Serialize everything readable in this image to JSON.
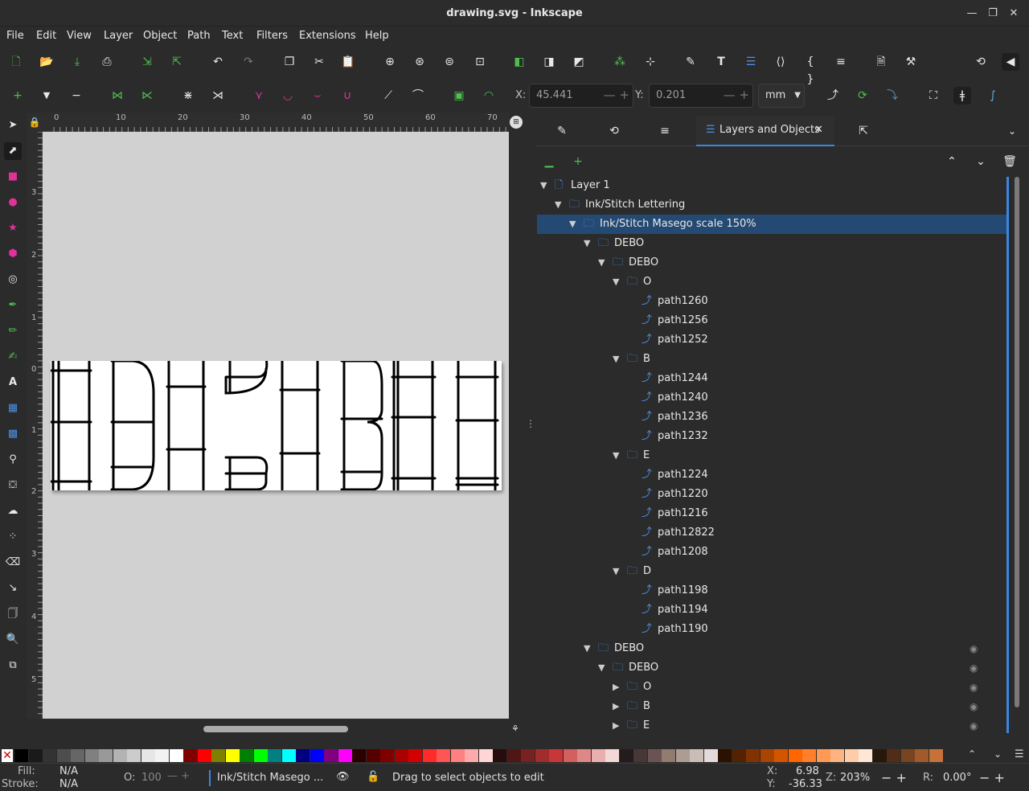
{
  "window": {
    "title": "drawing.svg - Inkscape"
  },
  "menu": [
    "File",
    "Edit",
    "View",
    "Layer",
    "Object",
    "Path",
    "Text",
    "Filters",
    "Extensions",
    "Help"
  ],
  "toolbar2": {
    "x_label": "X:",
    "x_value": "45.441",
    "y_label": "Y:",
    "y_value": "0.201",
    "unit": "mm"
  },
  "ruler_top": [
    "0",
    "10",
    "20",
    "30",
    "40",
    "50",
    "60",
    "70"
  ],
  "ruler_left": [
    "3",
    "2",
    "1",
    "0",
    "1",
    "2",
    "3",
    "4",
    "5"
  ],
  "panel": {
    "active_tab": "Layers and Objects"
  },
  "tree": [
    {
      "label": "Layer 1",
      "level": 0,
      "type": "layer",
      "expanded": true
    },
    {
      "label": "Ink/Stitch Lettering",
      "level": 1,
      "type": "group",
      "expanded": true
    },
    {
      "label": "Ink/Stitch Masego scale 150%",
      "level": 2,
      "type": "group",
      "expanded": true,
      "selected": true
    },
    {
      "label": "DEBO",
      "level": 3,
      "type": "group",
      "expanded": true
    },
    {
      "label": "DEBO",
      "level": 4,
      "type": "group",
      "expanded": true
    },
    {
      "label": "O",
      "level": 5,
      "type": "group",
      "expanded": true
    },
    {
      "label": "path1260",
      "level": 6,
      "type": "path"
    },
    {
      "label": "path1256",
      "level": 6,
      "type": "path"
    },
    {
      "label": "path1252",
      "level": 6,
      "type": "path"
    },
    {
      "label": "B",
      "level": 5,
      "type": "group",
      "expanded": true
    },
    {
      "label": "path1244",
      "level": 6,
      "type": "path"
    },
    {
      "label": "path1240",
      "level": 6,
      "type": "path"
    },
    {
      "label": "path1236",
      "level": 6,
      "type": "path"
    },
    {
      "label": "path1232",
      "level": 6,
      "type": "path"
    },
    {
      "label": "E",
      "level": 5,
      "type": "group",
      "expanded": true
    },
    {
      "label": "path1224",
      "level": 6,
      "type": "path"
    },
    {
      "label": "path1220",
      "level": 6,
      "type": "path"
    },
    {
      "label": "path1216",
      "level": 6,
      "type": "path"
    },
    {
      "label": "path12822",
      "level": 6,
      "type": "path"
    },
    {
      "label": "path1208",
      "level": 6,
      "type": "path"
    },
    {
      "label": "D",
      "level": 5,
      "type": "group",
      "expanded": true
    },
    {
      "label": "path1198",
      "level": 6,
      "type": "path"
    },
    {
      "label": "path1194",
      "level": 6,
      "type": "path"
    },
    {
      "label": "path1190",
      "level": 6,
      "type": "path"
    },
    {
      "label": "DEBO",
      "level": 3,
      "type": "group",
      "expanded": true,
      "hidden": true
    },
    {
      "label": "DEBO",
      "level": 4,
      "type": "group",
      "expanded": true,
      "hidden": true
    },
    {
      "label": "O",
      "level": 5,
      "type": "group",
      "expanded": false,
      "hidden": true
    },
    {
      "label": "B",
      "level": 5,
      "type": "group",
      "expanded": false,
      "hidden": true
    },
    {
      "label": "E",
      "level": 5,
      "type": "group",
      "expanded": false,
      "hidden": true
    }
  ],
  "status": {
    "fill_label": "Fill:",
    "fill_value": "N/A",
    "stroke_label": "Stroke:",
    "stroke_value": "N/A",
    "opacity_label": "O:",
    "opacity_value": "100",
    "layer": "Ink/Stitch Masego ...",
    "message": "Drag to select objects to edit",
    "x_label": "X:",
    "x_value": "6.98",
    "y_label": "Y:",
    "y_value": "-36.33",
    "zoom_label": "Z:",
    "zoom_value": "203%",
    "rotate_label": "R:",
    "rotate_value": "0.00°"
  },
  "palette": [
    "#000000",
    "#1a1a1a",
    "#333333",
    "#4d4d4d",
    "#666666",
    "#808080",
    "#999999",
    "#b3b3b3",
    "#cccccc",
    "#e6e6e6",
    "#f2f2f2",
    "#ffffff",
    "#800000",
    "#ff0000",
    "#808000",
    "#ffff00",
    "#008000",
    "#00ff00",
    "#008080",
    "#00ffff",
    "#000080",
    "#0000ff",
    "#800080",
    "#ff00ff",
    "#2b0000",
    "#550000",
    "#800000",
    "#aa0000",
    "#d40000",
    "#ff2a2a",
    "#ff5555",
    "#ff8080",
    "#ffaaaa",
    "#ffd5d5",
    "#280b0b",
    "#501616",
    "#782121",
    "#a02c2c",
    "#c83737",
    "#d35f5f",
    "#de8787",
    "#e9afaf",
    "#f4d7d7",
    "#241c1c",
    "#483737",
    "#6c5353",
    "#917c6f",
    "#ac9d93",
    "#c8beb7",
    "#e3dbdb",
    "#2b1100",
    "#552200",
    "#803300",
    "#aa4400",
    "#d45500",
    "#ff6600",
    "#ff7f2a",
    "#ff9955",
    "#ffb380",
    "#ffccaa",
    "#ffe6d5",
    "#28170b",
    "#502d16",
    "#784421",
    "#a05a2c",
    "#c87137"
  ]
}
